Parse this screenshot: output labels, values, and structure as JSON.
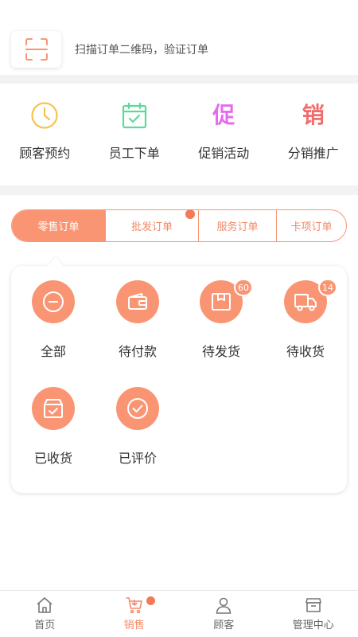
{
  "scan": {
    "icon": "scan-qr-icon",
    "hint": "扫描订单二维码，验证订单"
  },
  "quick_actions": [
    {
      "label": "顾客预约",
      "icon": "clock-icon",
      "color": "#f7c24f"
    },
    {
      "label": "员工下单",
      "icon": "calendar-check-icon",
      "color": "#5ed99a"
    },
    {
      "label": "促销活动",
      "icon": "promo-glyph-icon",
      "glyph": "促",
      "color": "#e56cf0"
    },
    {
      "label": "分销推广",
      "icon": "distribution-glyph-icon",
      "glyph": "销",
      "color": "#f26d6d"
    }
  ],
  "tabs": [
    {
      "label": "零售订单",
      "active": true
    },
    {
      "label": "批发订单",
      "active": false,
      "dot": true
    },
    {
      "label": "服务订单",
      "active": false
    },
    {
      "label": "卡项订单",
      "active": false
    }
  ],
  "orders": [
    {
      "label": "全部",
      "icon": "minus-circle-icon"
    },
    {
      "label": "待付款",
      "icon": "wallet-icon"
    },
    {
      "label": "待发货",
      "icon": "package-icon",
      "badge": "60"
    },
    {
      "label": "待收货",
      "icon": "truck-icon",
      "badge": "14"
    },
    {
      "label": "已收货",
      "icon": "received-box-icon"
    },
    {
      "label": "已评价",
      "icon": "check-circle-icon"
    }
  ],
  "nav": [
    {
      "label": "首页",
      "icon": "home-icon",
      "active": false
    },
    {
      "label": "销售",
      "icon": "sales-cart-icon",
      "active": true,
      "dot": true
    },
    {
      "label": "顾客",
      "icon": "customer-icon",
      "active": false
    },
    {
      "label": "管理中心",
      "icon": "management-icon",
      "active": false
    }
  ],
  "colors": {
    "accent": "#fa9574",
    "dot": "#f27a5a",
    "divider": "#f2f2f2"
  }
}
